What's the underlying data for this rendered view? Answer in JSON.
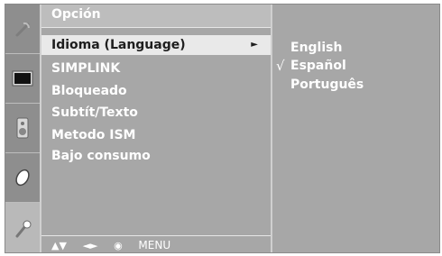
{
  "menu": {
    "title": "Opción",
    "items": [
      {
        "label": "Idioma (Language)",
        "selected": true,
        "has_submenu": true
      },
      {
        "label": "SIMPLINK"
      },
      {
        "label": "Bloqueado"
      },
      {
        "label": "Subtít/Texto"
      },
      {
        "label": "Metodo ISM"
      },
      {
        "label": "Bajo consumo"
      }
    ],
    "submenu_arrow": "►"
  },
  "footer": {
    "up_down": "▲▼",
    "left_right": "◄►",
    "ok": "◉",
    "menu_label": "MENU"
  },
  "options": {
    "items": [
      {
        "label": "English"
      },
      {
        "label": "Español",
        "checked": true
      },
      {
        "label": "Português"
      }
    ],
    "check_mark": "√"
  },
  "sidebar": {
    "icons": [
      "satellite-dish-icon",
      "screen-icon",
      "speaker-icon",
      "clock-icon",
      "key-icon"
    ],
    "active_index": 4
  },
  "colors": {
    "panel": "#a7a7a7",
    "sidebar": "#8e8e8e",
    "selected_row": "#e9e9e9",
    "text": "#ffffff"
  }
}
